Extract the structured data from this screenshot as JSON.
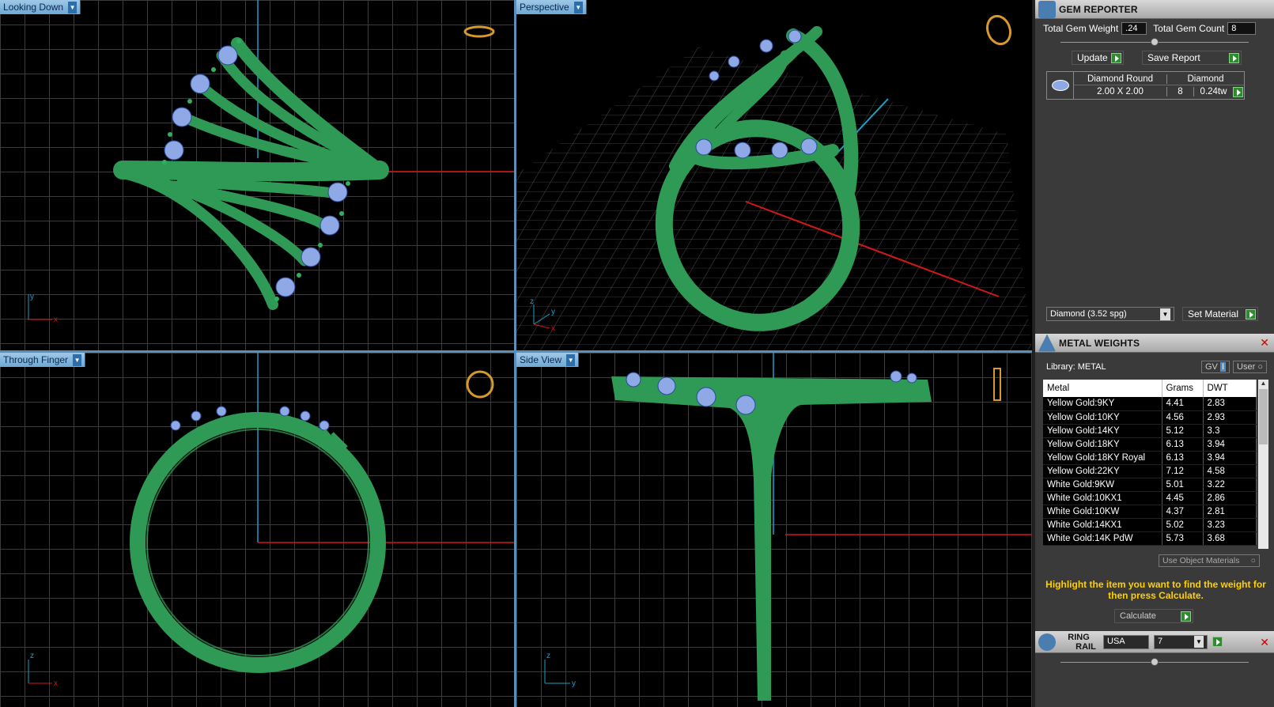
{
  "viewports": [
    {
      "tab": "Looking Down"
    },
    {
      "tab": "Perspective"
    },
    {
      "tab": "Through Finger"
    },
    {
      "tab": "Side View"
    }
  ],
  "axes": {
    "top_left": [
      "y",
      "x"
    ],
    "perspective": [
      "z",
      "y",
      "x"
    ],
    "bottom_left": [
      "z",
      "x"
    ],
    "bottom_right": [
      "z",
      "y"
    ]
  },
  "gem_reporter": {
    "title": "GEM REPORTER",
    "total_weight_label": "Total Gem Weight",
    "total_weight": ".24",
    "total_count_label": "Total Gem Count",
    "total_count": "8",
    "update_label": "Update",
    "save_report_label": "Save Report",
    "gem": {
      "shape": "Diamond Round",
      "size": "2.00 X 2.00",
      "material": "Diamond",
      "count": "8",
      "weight": "0.24tw"
    },
    "material_select": "Diamond    (3.52 spg)",
    "set_material_label": "Set Material"
  },
  "metal_weights": {
    "title": "METAL WEIGHTS",
    "library_label": "Library: METAL",
    "gv_label": "GV",
    "user_label": "User",
    "columns": [
      "Metal",
      "Grams",
      "DWT"
    ],
    "rows": [
      [
        "Yellow Gold:9KY",
        "4.41",
        "2.83"
      ],
      [
        "Yellow Gold:10KY",
        "4.56",
        "2.93"
      ],
      [
        "Yellow Gold:14KY",
        "5.12",
        "3.3"
      ],
      [
        "Yellow Gold:18KY",
        "6.13",
        "3.94"
      ],
      [
        "Yellow Gold:18KY Royal",
        "6.13",
        "3.94"
      ],
      [
        "Yellow Gold:22KY",
        "7.12",
        "4.58"
      ],
      [
        "White Gold:9KW",
        "5.01",
        "3.22"
      ],
      [
        "White Gold:10KX1",
        "4.45",
        "2.86"
      ],
      [
        "White Gold:10KW",
        "4.37",
        "2.81"
      ],
      [
        "White Gold:14KX1",
        "5.02",
        "3.23"
      ],
      [
        "White Gold:14K PdW",
        "5.73",
        "3.68"
      ]
    ],
    "use_object_materials_label": "Use Object Materials",
    "hint": "Highlight the item you want to find the weight for then press Calculate.",
    "calculate_label": "Calculate"
  },
  "ring_rail": {
    "title_line1": "RING",
    "title_line2": "RAIL",
    "country": "USA",
    "size": "7"
  },
  "colors": {
    "metal": "#2f9a55",
    "gem": "#8fa8e6",
    "axis_x": "#d01818",
    "axis_y": "#1aa0c8",
    "tab": "#7ab3de",
    "hint": "#ffd000"
  }
}
